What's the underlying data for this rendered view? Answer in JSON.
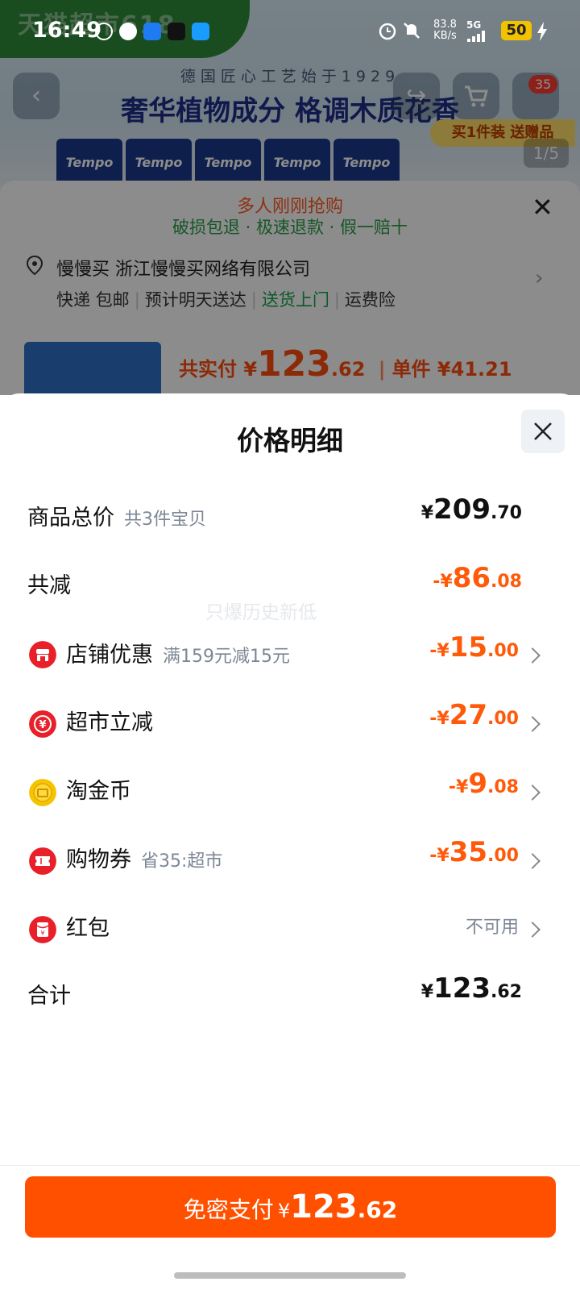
{
  "status_bar": {
    "time": "16:49",
    "net_speed": "83.8",
    "net_unit": "KB/s",
    "network": "5G",
    "battery": "50"
  },
  "background": {
    "banner_brand": "天猫超市618",
    "slogan_top": "德国匠心工艺始于1929",
    "slogan_main": "奢华植物成分 格调木质花香",
    "tissue_brand": "Tempo",
    "cart_badge": "35",
    "gift_tag": "买1件装 送赠品",
    "page_indicator": "1/5",
    "rush_text": "多人刚刚抢购",
    "guarantee_text": "破损包退 · 极速退款 · 假一赔十",
    "address": "慢慢买 浙江慢慢买网络有限公司",
    "shipping": [
      "快递 包邮",
      "预计明天送达",
      "送货上门",
      "运费险"
    ],
    "price_label": "共实付 ¥",
    "price_int": "123",
    "price_dec": ".62",
    "unit_price": "单件 ¥41.21"
  },
  "modal": {
    "title": "价格明细",
    "watermark": "只爆历史新低",
    "total_goods": {
      "label": "商品总价",
      "sub": "共3件宝贝",
      "currency": "¥",
      "int": "209",
      "dec": ".70"
    },
    "total_discount": {
      "label": "共减",
      "currency": "-¥",
      "int": "86",
      "dec": ".08"
    },
    "store_discount": {
      "label": "店铺优惠",
      "sub": "满159元减15元",
      "currency": "-¥",
      "int": "15",
      "dec": ".00",
      "icon": "store-icon"
    },
    "market_discount": {
      "label": "超市立减",
      "currency": "-¥",
      "int": "27",
      "dec": ".00",
      "icon": "yuan-icon"
    },
    "gold_coin": {
      "label": "淘金币",
      "currency": "-¥",
      "int": "9",
      "dec": ".08",
      "icon": "coin-icon"
    },
    "voucher": {
      "label": "购物券",
      "sub": "省35:超市",
      "currency": "-¥",
      "int": "35",
      "dec": ".00",
      "icon": "ticket-icon"
    },
    "red_packet": {
      "label": "红包",
      "value": "不可用",
      "icon": "red-packet-icon"
    },
    "subtotal": {
      "label": "合计",
      "currency": "¥",
      "int": "123",
      "dec": ".62"
    }
  },
  "pay_button": {
    "label": "免密支付",
    "currency": "¥",
    "int": "123",
    "dec": ".62"
  },
  "colors": {
    "accent": "#ff5000",
    "discount": "#ff5a0a",
    "icon_red": "#e8202a",
    "coin_gold": "#f5c400"
  }
}
